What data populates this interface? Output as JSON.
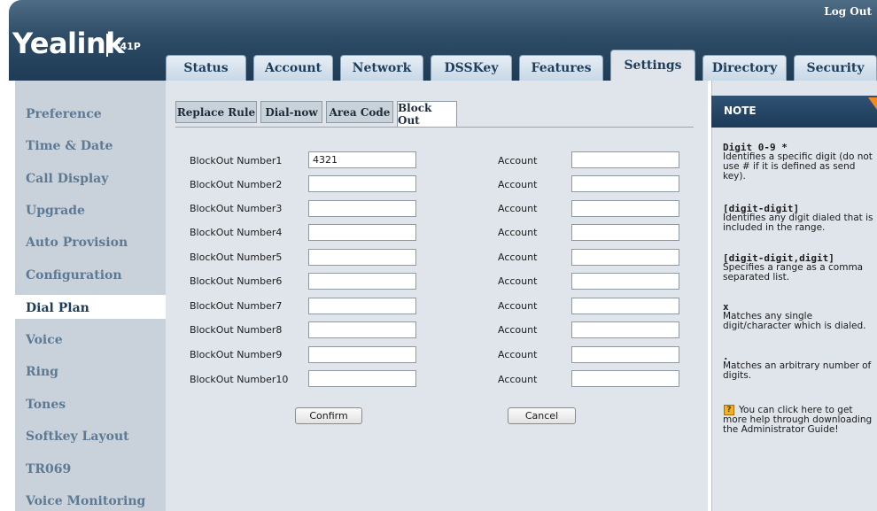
{
  "header": {
    "logo": "Yealink",
    "model": "T41P",
    "logout": "Log Out",
    "tabs": [
      {
        "label": "Status",
        "active": false
      },
      {
        "label": "Account",
        "active": false
      },
      {
        "label": "Network",
        "active": false
      },
      {
        "label": "DSSKey",
        "active": false
      },
      {
        "label": "Features",
        "active": false
      },
      {
        "label": "Settings",
        "active": true
      },
      {
        "label": "Directory",
        "active": false
      },
      {
        "label": "Security",
        "active": false
      }
    ]
  },
  "sidebar": {
    "items": [
      {
        "label": "Preference",
        "active": false
      },
      {
        "label": "Time & Date",
        "active": false
      },
      {
        "label": "Call Display",
        "active": false
      },
      {
        "label": "Upgrade",
        "active": false
      },
      {
        "label": "Auto Provision",
        "active": false
      },
      {
        "label": "Configuration",
        "active": false
      },
      {
        "label": "Dial Plan",
        "active": true
      },
      {
        "label": "Voice",
        "active": false
      },
      {
        "label": "Ring",
        "active": false
      },
      {
        "label": "Tones",
        "active": false
      },
      {
        "label": "Softkey Layout",
        "active": false
      },
      {
        "label": "TR069",
        "active": false
      },
      {
        "label": "Voice Monitoring",
        "active": false
      }
    ]
  },
  "subtabs": [
    {
      "label": "Replace Rule",
      "active": false
    },
    {
      "label": "Dial-now",
      "active": false
    },
    {
      "label": "Area Code",
      "active": false
    },
    {
      "label": "Block Out",
      "active": true
    }
  ],
  "form": {
    "account_label": "Account",
    "rows": [
      {
        "label": "BlockOut Number1",
        "value": "4321",
        "account": ""
      },
      {
        "label": "BlockOut Number2",
        "value": "",
        "account": ""
      },
      {
        "label": "BlockOut Number3",
        "value": "",
        "account": ""
      },
      {
        "label": "BlockOut Number4",
        "value": "",
        "account": ""
      },
      {
        "label": "BlockOut Number5",
        "value": "",
        "account": ""
      },
      {
        "label": "BlockOut Number6",
        "value": "",
        "account": ""
      },
      {
        "label": "BlockOut Number7",
        "value": "",
        "account": ""
      },
      {
        "label": "BlockOut Number8",
        "value": "",
        "account": ""
      },
      {
        "label": "BlockOut Number9",
        "value": "",
        "account": ""
      },
      {
        "label": "BlockOut Number10",
        "value": "",
        "account": ""
      }
    ],
    "confirm": "Confirm",
    "cancel": "Cancel"
  },
  "note": {
    "title": "NOTE",
    "items": [
      {
        "heading": "Digit 0-9 *",
        "body": "Identifies a specific digit (do not use # if it is defined as send key)."
      },
      {
        "heading": "[digit-digit]",
        "body": "Identifies any digit dialed that is included in the range."
      },
      {
        "heading": "[digit-digit,digit]",
        "body": "Specifies a range as a comma separated list."
      },
      {
        "heading": "x",
        "body": "Matches any single digit/character which is dialed."
      },
      {
        "heading": ".",
        "body": "Matches an arbitrary number of digits."
      }
    ],
    "help_icon": "?",
    "help_text": "You can click here to get more help through downloading the Administrator Guide!"
  },
  "colors": {
    "header": "#2e4c66",
    "sidebar": "#c9d2da",
    "panel": "#dfe5eb",
    "note_title": "#1d3a58",
    "accent": "#f08a24"
  }
}
